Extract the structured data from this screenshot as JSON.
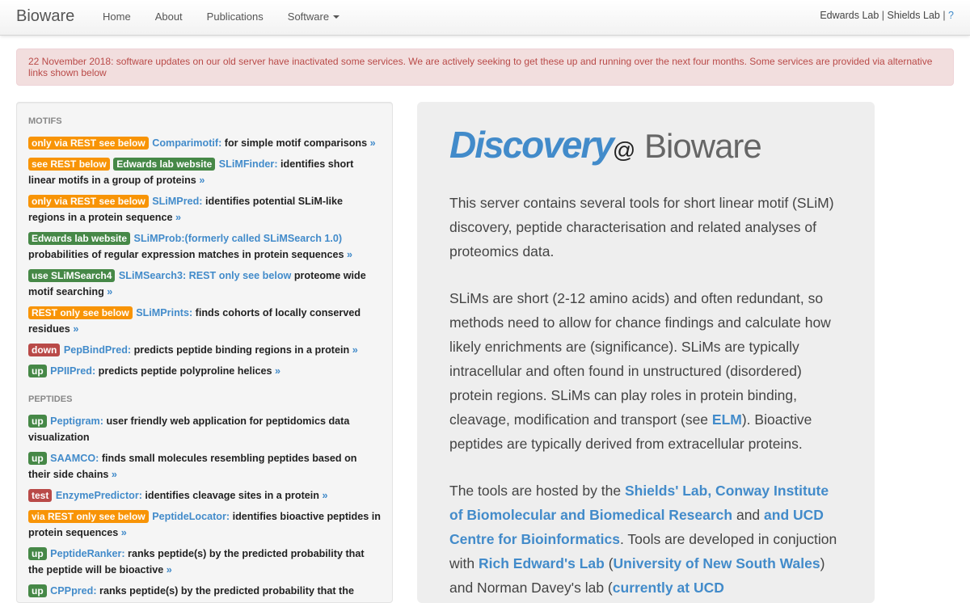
{
  "navbar": {
    "brand": "Bioware",
    "items": [
      "Home",
      "About",
      "Publications",
      "Software"
    ],
    "right": {
      "edwards": "Edwards Lab",
      "sep1": " | ",
      "shields": "Shields Lab",
      "sep2": " | ",
      "help": "?"
    }
  },
  "alert": {
    "text": "22 November 2018: software updates on our old server have inactivated some services. We are actively seeking to get these up and running over the next four months. Some services are provided via alternative links shown below"
  },
  "sidebar": {
    "motifs_header": "MOTIFS",
    "peptides_header": "PEPTIDES",
    "motifs": [
      {
        "badges": [
          {
            "text": "only via REST see below",
            "kind": "warning"
          }
        ],
        "name": "Comparimotif:",
        "desc": " for simple motif comparisons ",
        "raquo": "»"
      },
      {
        "badges": [
          {
            "text": "see REST below",
            "kind": "warning"
          },
          {
            "text": "Edwards lab website",
            "kind": "success"
          }
        ],
        "name": "SLiMFinder:",
        "desc": " identifies short linear motifs in a group of proteins ",
        "raquo": "»"
      },
      {
        "badges": [
          {
            "text": "only via REST see below",
            "kind": "warning"
          }
        ],
        "name": "SLiMPred:",
        "desc": " identifies potential SLiM-like regions in a protein sequence ",
        "raquo": "»"
      },
      {
        "badges": [
          {
            "text": "Edwards lab website",
            "kind": "success"
          }
        ],
        "name": "SLiMProb:(formerly called SLiMSearch 1.0)",
        "desc": " probabilities of regular expression matches in protein sequences ",
        "raquo": "»"
      },
      {
        "badges": [
          {
            "text": "use SLiMSearch4",
            "kind": "success"
          }
        ],
        "name": "SLiMSearch3: REST only see below",
        "desc": " proteome wide motif searching ",
        "raquo": "»"
      },
      {
        "badges": [
          {
            "text": "REST only see below",
            "kind": "warning"
          }
        ],
        "name": "SLiMPrints:",
        "desc": " finds cohorts of locally conserved residues ",
        "raquo": "»"
      },
      {
        "badges": [
          {
            "text": "down",
            "kind": "important"
          }
        ],
        "name": "PepBindPred:",
        "desc": " predicts peptide binding regions in a protein ",
        "raquo": "»"
      },
      {
        "badges": [
          {
            "text": "up",
            "kind": "success"
          }
        ],
        "name": "PPIIPred:",
        "desc": " predicts peptide polyproline helices ",
        "raquo": "»"
      }
    ],
    "peptides": [
      {
        "badges": [
          {
            "text": "up",
            "kind": "success"
          }
        ],
        "name": "Peptigram:",
        "desc": " user friendly web application for peptidomics data visualization",
        "raquo": ""
      },
      {
        "badges": [
          {
            "text": "up",
            "kind": "success"
          }
        ],
        "name": "SAAMCO:",
        "desc": " finds small molecules resembling peptides based on their side chains ",
        "raquo": "»"
      },
      {
        "badges": [
          {
            "text": "test",
            "kind": "important"
          }
        ],
        "name": "EnzymePredictor:",
        "desc": " identifies cleavage sites in a protein ",
        "raquo": "»"
      },
      {
        "badges": [
          {
            "text": "via REST only see below",
            "kind": "warning"
          }
        ],
        "name": "PeptideLocator:",
        "desc": " identifies bioactive peptides in protein sequences ",
        "raquo": "»"
      },
      {
        "badges": [
          {
            "text": "up",
            "kind": "success"
          }
        ],
        "name": "PeptideRanker:",
        "desc": " ranks peptide(s) by the predicted probability that the peptide will be bioactive ",
        "raquo": "»"
      },
      {
        "badges": [
          {
            "text": "up",
            "kind": "success"
          }
        ],
        "name": "CPPpred:",
        "desc": " ranks peptide(s) by the predicted probability that the peptide will be cell penetrating ",
        "raquo": "»"
      }
    ]
  },
  "hero": {
    "title_discovery": "Discovery",
    "title_at": "@",
    "title_bioware": " Bioware",
    "p1": "This server contains several tools for short linear motif (SLiM) discovery, peptide characterisation and related analyses of proteomics data.",
    "p2_a": "SLiMs are short (2-12 amino acids) and often redundant, so methods need to allow for chance findings and calculate how likely enrichments are (significance). SLiMs are typically intracellular and often found in unstructured (disordered) protein regions. SLiMs can play roles in protein binding, cleavage, modification and transport (see ",
    "p2_link": "ELM",
    "p2_b": "). Bioactive peptides are typically derived from extracellular proteins.",
    "p3_a": "The tools are hosted by the ",
    "p3_link1": "Shields' Lab, Conway Institute of Biomolecular and Biomedical Research",
    "p3_b": " and ",
    "p3_link2": "and UCD Centre for Bioinformatics",
    "p3_c": ". Tools are developed in conjuction with ",
    "p3_link3": "Rich Edward's Lab",
    "p3_d": " (",
    "p3_link4": "University of New South Wales",
    "p3_e": ") and Norman Davey's lab (",
    "p3_link5": "currently at UCD"
  }
}
